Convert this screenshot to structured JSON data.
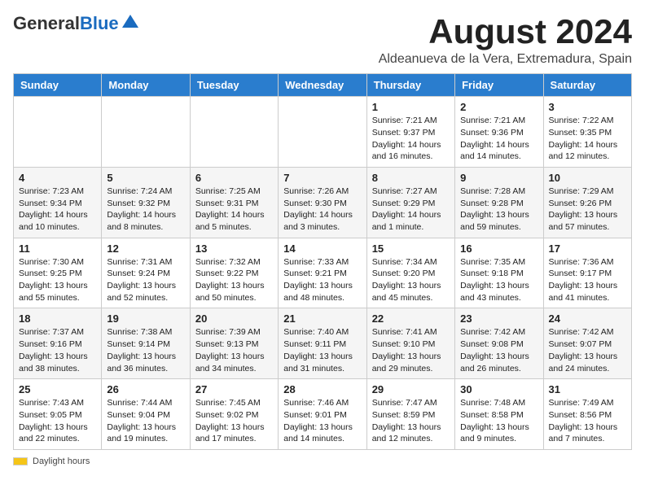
{
  "header": {
    "logo_general": "General",
    "logo_blue": "Blue",
    "month_title": "August 2024",
    "subtitle": "Aldeanueva de la Vera, Extremadura, Spain"
  },
  "weekdays": [
    "Sunday",
    "Monday",
    "Tuesday",
    "Wednesday",
    "Thursday",
    "Friday",
    "Saturday"
  ],
  "weeks": [
    [
      {
        "day": "",
        "info": ""
      },
      {
        "day": "",
        "info": ""
      },
      {
        "day": "",
        "info": ""
      },
      {
        "day": "",
        "info": ""
      },
      {
        "day": "1",
        "info": "Sunrise: 7:21 AM\nSunset: 9:37 PM\nDaylight: 14 hours\nand 16 minutes."
      },
      {
        "day": "2",
        "info": "Sunrise: 7:21 AM\nSunset: 9:36 PM\nDaylight: 14 hours\nand 14 minutes."
      },
      {
        "day": "3",
        "info": "Sunrise: 7:22 AM\nSunset: 9:35 PM\nDaylight: 14 hours\nand 12 minutes."
      }
    ],
    [
      {
        "day": "4",
        "info": "Sunrise: 7:23 AM\nSunset: 9:34 PM\nDaylight: 14 hours\nand 10 minutes."
      },
      {
        "day": "5",
        "info": "Sunrise: 7:24 AM\nSunset: 9:32 PM\nDaylight: 14 hours\nand 8 minutes."
      },
      {
        "day": "6",
        "info": "Sunrise: 7:25 AM\nSunset: 9:31 PM\nDaylight: 14 hours\nand 5 minutes."
      },
      {
        "day": "7",
        "info": "Sunrise: 7:26 AM\nSunset: 9:30 PM\nDaylight: 14 hours\nand 3 minutes."
      },
      {
        "day": "8",
        "info": "Sunrise: 7:27 AM\nSunset: 9:29 PM\nDaylight: 14 hours\nand 1 minute."
      },
      {
        "day": "9",
        "info": "Sunrise: 7:28 AM\nSunset: 9:28 PM\nDaylight: 13 hours\nand 59 minutes."
      },
      {
        "day": "10",
        "info": "Sunrise: 7:29 AM\nSunset: 9:26 PM\nDaylight: 13 hours\nand 57 minutes."
      }
    ],
    [
      {
        "day": "11",
        "info": "Sunrise: 7:30 AM\nSunset: 9:25 PM\nDaylight: 13 hours\nand 55 minutes."
      },
      {
        "day": "12",
        "info": "Sunrise: 7:31 AM\nSunset: 9:24 PM\nDaylight: 13 hours\nand 52 minutes."
      },
      {
        "day": "13",
        "info": "Sunrise: 7:32 AM\nSunset: 9:22 PM\nDaylight: 13 hours\nand 50 minutes."
      },
      {
        "day": "14",
        "info": "Sunrise: 7:33 AM\nSunset: 9:21 PM\nDaylight: 13 hours\nand 48 minutes."
      },
      {
        "day": "15",
        "info": "Sunrise: 7:34 AM\nSunset: 9:20 PM\nDaylight: 13 hours\nand 45 minutes."
      },
      {
        "day": "16",
        "info": "Sunrise: 7:35 AM\nSunset: 9:18 PM\nDaylight: 13 hours\nand 43 minutes."
      },
      {
        "day": "17",
        "info": "Sunrise: 7:36 AM\nSunset: 9:17 PM\nDaylight: 13 hours\nand 41 minutes."
      }
    ],
    [
      {
        "day": "18",
        "info": "Sunrise: 7:37 AM\nSunset: 9:16 PM\nDaylight: 13 hours\nand 38 minutes."
      },
      {
        "day": "19",
        "info": "Sunrise: 7:38 AM\nSunset: 9:14 PM\nDaylight: 13 hours\nand 36 minutes."
      },
      {
        "day": "20",
        "info": "Sunrise: 7:39 AM\nSunset: 9:13 PM\nDaylight: 13 hours\nand 34 minutes."
      },
      {
        "day": "21",
        "info": "Sunrise: 7:40 AM\nSunset: 9:11 PM\nDaylight: 13 hours\nand 31 minutes."
      },
      {
        "day": "22",
        "info": "Sunrise: 7:41 AM\nSunset: 9:10 PM\nDaylight: 13 hours\nand 29 minutes."
      },
      {
        "day": "23",
        "info": "Sunrise: 7:42 AM\nSunset: 9:08 PM\nDaylight: 13 hours\nand 26 minutes."
      },
      {
        "day": "24",
        "info": "Sunrise: 7:42 AM\nSunset: 9:07 PM\nDaylight: 13 hours\nand 24 minutes."
      }
    ],
    [
      {
        "day": "25",
        "info": "Sunrise: 7:43 AM\nSunset: 9:05 PM\nDaylight: 13 hours\nand 22 minutes."
      },
      {
        "day": "26",
        "info": "Sunrise: 7:44 AM\nSunset: 9:04 PM\nDaylight: 13 hours\nand 19 minutes."
      },
      {
        "day": "27",
        "info": "Sunrise: 7:45 AM\nSunset: 9:02 PM\nDaylight: 13 hours\nand 17 minutes."
      },
      {
        "day": "28",
        "info": "Sunrise: 7:46 AM\nSunset: 9:01 PM\nDaylight: 13 hours\nand 14 minutes."
      },
      {
        "day": "29",
        "info": "Sunrise: 7:47 AM\nSunset: 8:59 PM\nDaylight: 13 hours\nand 12 minutes."
      },
      {
        "day": "30",
        "info": "Sunrise: 7:48 AM\nSunset: 8:58 PM\nDaylight: 13 hours\nand 9 minutes."
      },
      {
        "day": "31",
        "info": "Sunrise: 7:49 AM\nSunset: 8:56 PM\nDaylight: 13 hours\nand 7 minutes."
      }
    ]
  ],
  "footer": {
    "daylight_label": "Daylight hours"
  }
}
